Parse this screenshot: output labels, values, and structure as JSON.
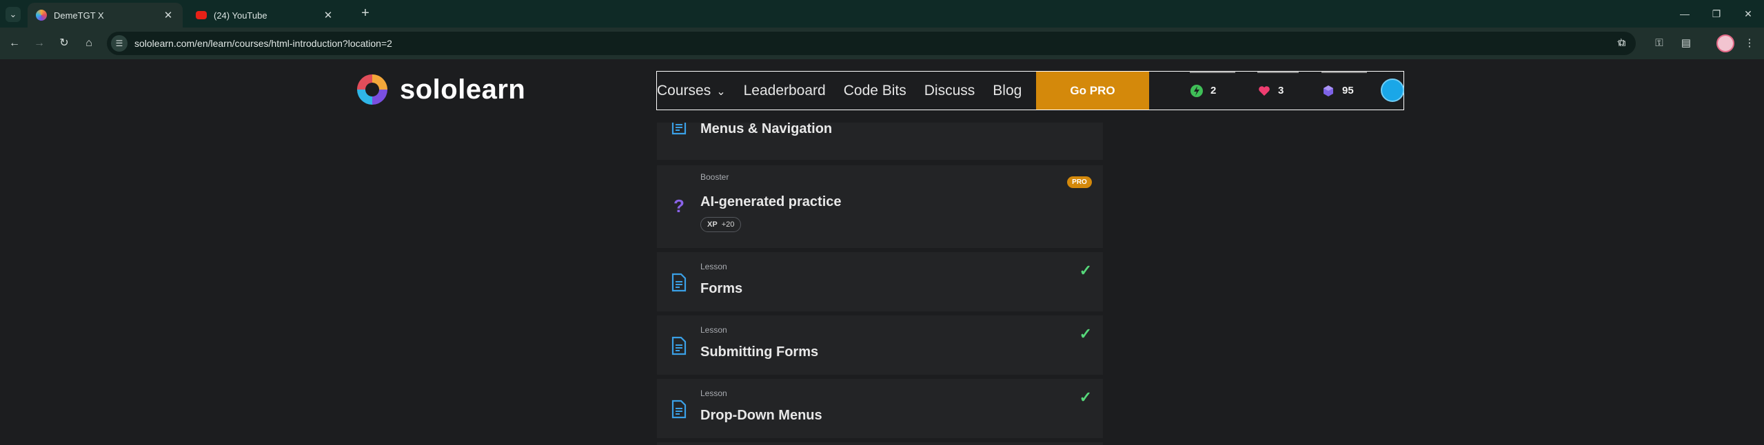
{
  "browser": {
    "tabs": [
      {
        "title": "DemeTGT X",
        "active": true
      },
      {
        "title": "(24) YouTube",
        "active": false
      }
    ],
    "url": "sololearn.com/en/learn/courses/html-introduction?location=2"
  },
  "header": {
    "logo_text": "sololearn",
    "nav": {
      "courses": "Courses",
      "leaderboard": "Leaderboard",
      "code_bits": "Code Bits",
      "discuss": "Discuss",
      "blog": "Blog"
    },
    "go_pro": "Go PRO",
    "stats": {
      "streak": "2",
      "hearts": "3",
      "gems": "95"
    }
  },
  "lessons": [
    {
      "kind": "",
      "title": "Menus & Navigation",
      "completed": true,
      "icon": "lesson-doc-icon"
    },
    {
      "kind": "Booster",
      "title": "AI-generated practice",
      "completed": false,
      "pro": "PRO",
      "xp_label": "XP",
      "xp_value": "+20",
      "icon": "question-mark-icon"
    },
    {
      "kind": "Lesson",
      "title": "Forms",
      "completed": true,
      "icon": "lesson-doc-icon"
    },
    {
      "kind": "Lesson",
      "title": "Submitting Forms",
      "completed": true,
      "icon": "lesson-doc-icon"
    },
    {
      "kind": "Lesson",
      "title": "Drop-Down Menus",
      "completed": true,
      "icon": "lesson-doc-icon"
    }
  ],
  "colors": {
    "accent_pro": "#d4890b",
    "check": "#56d87a",
    "lesson_icon": "#3aa0e6",
    "booster_icon": "#8a63e8"
  }
}
